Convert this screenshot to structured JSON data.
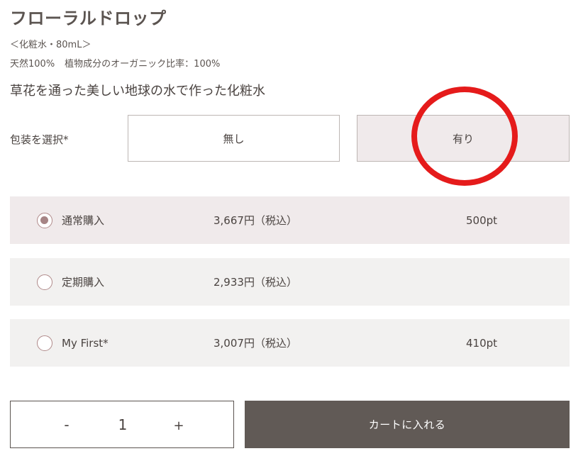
{
  "product": {
    "title": "フローラルドロップ",
    "spec": "＜化粧水・80mL＞",
    "ratio_natural": "天然100%",
    "ratio_organic": "植物成分のオーガニック比率：100%",
    "tagline": "草花を通った美しい地球の水で作った化粧水"
  },
  "wrapping": {
    "label": "包装を選択*",
    "options": [
      {
        "label": "無し",
        "selected": false
      },
      {
        "label": "有り",
        "selected": true
      }
    ]
  },
  "plans": [
    {
      "name": "通常購入",
      "price": "3,667円（税込）",
      "points": "500pt",
      "selected": true
    },
    {
      "name": "定期購入",
      "price": "2,933円（税込）",
      "points": "",
      "selected": false
    },
    {
      "name": "My First*",
      "price": "3,007円（税込）",
      "points": "410pt",
      "selected": false
    }
  ],
  "quantity": {
    "minus_label": "-",
    "value": "1",
    "plus_label": "+"
  },
  "cart": {
    "label": "カートに入れる"
  },
  "colors": {
    "accent_circle": "#e51b1b",
    "selected_bg": "#f0eaeb",
    "row_bg": "#f2f1f0",
    "button_bg": "#615a56",
    "radio_fill": "#a68485"
  }
}
